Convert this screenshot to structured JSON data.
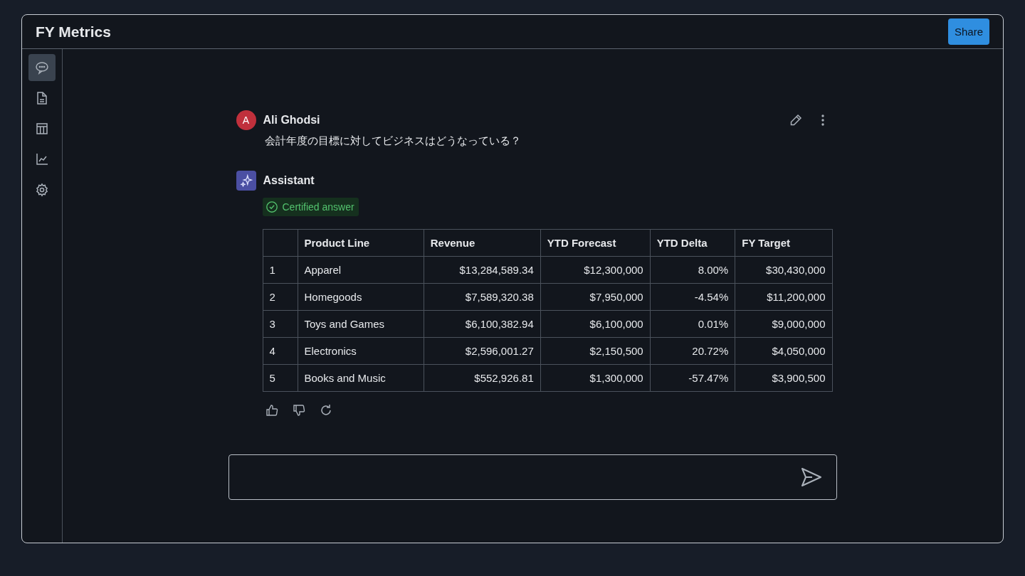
{
  "window": {
    "title": "FY Metrics",
    "share_button": "Share"
  },
  "sidebar": {
    "items": [
      {
        "kind": "chat",
        "selected": true
      },
      {
        "kind": "document",
        "selected": false
      },
      {
        "kind": "table",
        "selected": false
      },
      {
        "kind": "chart",
        "selected": false
      },
      {
        "kind": "settings",
        "selected": false
      }
    ]
  },
  "conversation": [
    {
      "kind": "user",
      "avatar": "A",
      "author": "Ali Ghodsi",
      "text": "会計年度の目標に対してビジネスはどうなっている？"
    },
    {
      "kind": "assistant",
      "author": "Assistant",
      "badge": "Certified answer",
      "table": {
        "columns": [
          "",
          "Product Line",
          "Revenue",
          "YTD Forecast",
          "YTD Delta",
          "FY Target"
        ],
        "rows": [
          [
            "1",
            "Apparel",
            "$13,284,589.34",
            "$12,300,000",
            "8.00%",
            "$30,430,000"
          ],
          [
            "2",
            "Homegoods",
            "$7,589,320.38",
            "$7,950,000",
            "-4.54%",
            "$11,200,000"
          ],
          [
            "3",
            "Toys and Games",
            "$6,100,382.94",
            "$6,100,000",
            "0.01%",
            "$9,000,000"
          ],
          [
            "4",
            "Electronics",
            "$2,596,001.27",
            "$2,150,500",
            "20.72%",
            "$4,050,000"
          ],
          [
            "5",
            "Books and Music",
            "$552,926.81",
            "$1,300,000",
            "-57.47%",
            "$3,900,500"
          ]
        ]
      }
    }
  ],
  "composer": {
    "kind": "text"
  }
}
